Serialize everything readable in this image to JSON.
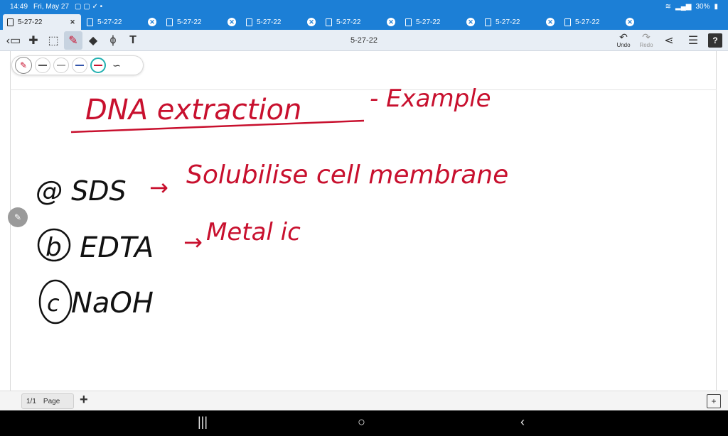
{
  "status": {
    "time": "14:49",
    "date": "Fri, May 27",
    "battery": "30%"
  },
  "tabs": [
    {
      "label": "5-27-22",
      "active": true
    },
    {
      "label": "5-27-22",
      "active": false
    },
    {
      "label": "5-27-22",
      "active": false
    },
    {
      "label": "5-27-22",
      "active": false
    },
    {
      "label": "5-27-22",
      "active": false
    },
    {
      "label": "5-27-22",
      "active": false
    },
    {
      "label": "5-27-22",
      "active": false
    },
    {
      "label": "5-27-22",
      "active": false
    }
  ],
  "toolbar": {
    "title": "5-27-22",
    "undo_label": "Undo",
    "redo_label": "Redo"
  },
  "pen": {
    "current_color": "#c8102e",
    "swatches": [
      "#555555",
      "#aaaaaa",
      "#3355aa",
      "#c8102e"
    ],
    "selected_index": 3
  },
  "notes": {
    "title_a": "DNA extraction",
    "title_b": "- Example",
    "line1_label": "@ SDS",
    "line1_arrow": "→",
    "line1_text": "Solubilise cell membrane",
    "line2_label": "EDTA",
    "line2_arrow": "→",
    "line2_text": "Metal ic",
    "line3_label": "NaOH",
    "mark_b": "b",
    "mark_c": "c"
  },
  "colors": {
    "accent": "#1c7fd6",
    "ink_red": "#c8102e",
    "ink_black": "#111111"
  },
  "footer": {
    "page_count": "1/1",
    "page_label": "Page"
  }
}
